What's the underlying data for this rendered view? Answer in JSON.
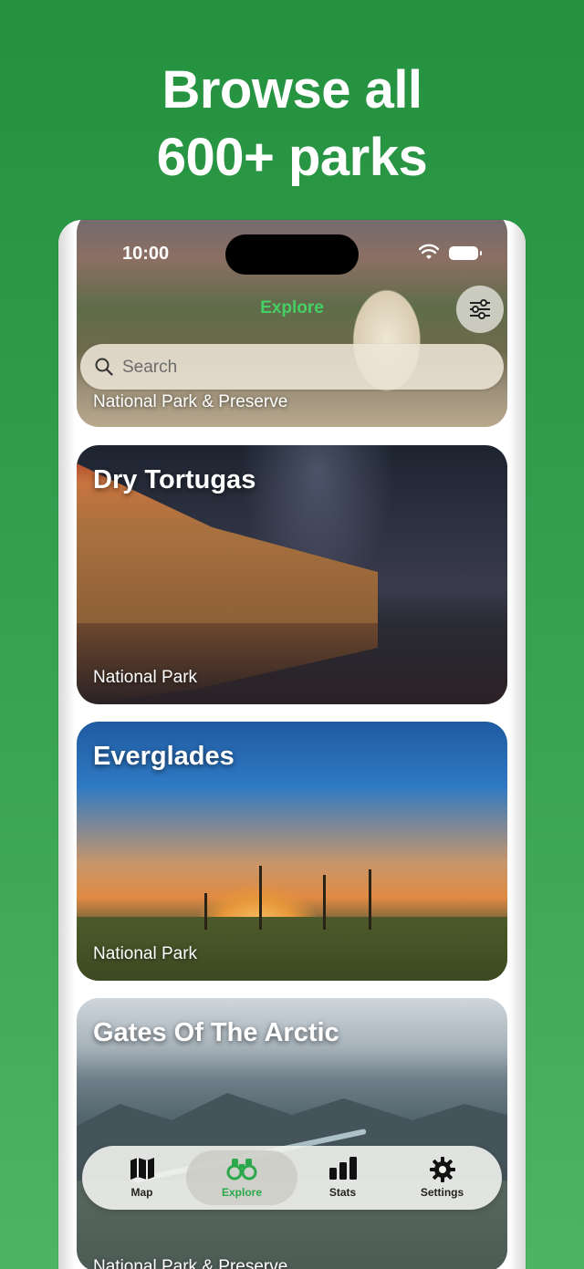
{
  "headline": {
    "line1": "Browse all",
    "line2": "600+ parks"
  },
  "status_bar": {
    "time": "10:00"
  },
  "nav": {
    "title": "Explore"
  },
  "search": {
    "placeholder": "Search"
  },
  "parks": [
    {
      "name": "",
      "type": "National Park & Preserve"
    },
    {
      "name": "Dry Tortugas",
      "type": "National Park"
    },
    {
      "name": "Everglades",
      "type": "National Park"
    },
    {
      "name": "Gates Of The Arctic",
      "type": "National Park & Preserve"
    }
  ],
  "tabs": [
    {
      "label": "Map",
      "icon": "map-icon"
    },
    {
      "label": "Explore",
      "icon": "binoculars-icon"
    },
    {
      "label": "Stats",
      "icon": "bar-chart-icon"
    },
    {
      "label": "Settings",
      "icon": "gear-icon"
    }
  ],
  "colors": {
    "background": "#2e9a4a",
    "accent": "#2aa84a"
  }
}
